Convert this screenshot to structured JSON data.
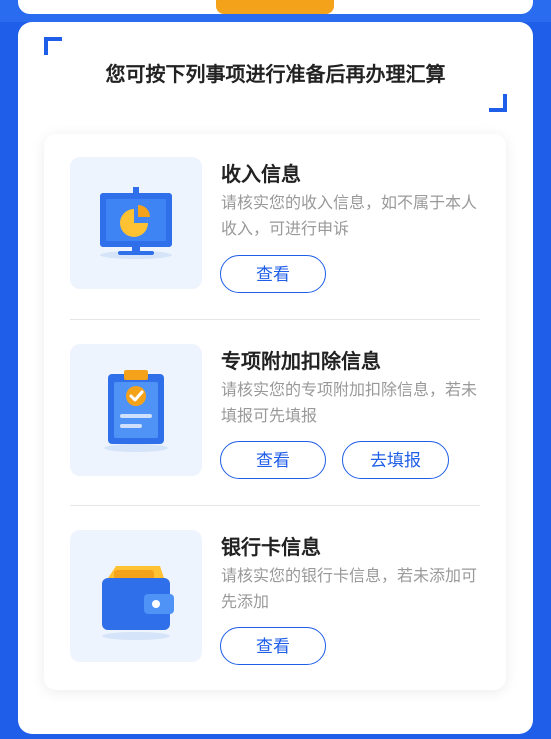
{
  "header": {
    "title": "您可按下列事项进行准备后再办理汇算"
  },
  "items": [
    {
      "title": "收入信息",
      "desc": "请核实您的收入信息，如不属于本人收入，可进行申诉",
      "buttons": [
        "查看"
      ],
      "icon": "presentation-chart-icon"
    },
    {
      "title": "专项附加扣除信息",
      "desc": "请核实您的专项附加扣除信息，若未填报可先填报",
      "buttons": [
        "查看",
        "去填报"
      ],
      "icon": "clipboard-check-icon"
    },
    {
      "title": "银行卡信息",
      "desc": "请核实您的银行卡信息，若未添加可先添加",
      "buttons": [
        "查看"
      ],
      "icon": "wallet-icon"
    }
  ],
  "colors": {
    "primary": "#1f5ee8",
    "accent": "#f5a21b",
    "title": "#222222",
    "desc": "#999999"
  }
}
